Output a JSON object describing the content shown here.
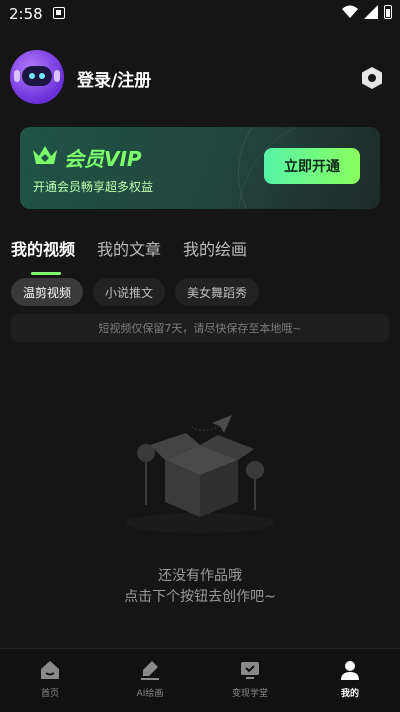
{
  "status": {
    "time": "2:58"
  },
  "profile": {
    "login_label": "登录/注册"
  },
  "vip": {
    "title": "会员VIP",
    "subtitle": "开通会员畅享超多权益",
    "button": "立即开通",
    "accent": "#7dff6b"
  },
  "tabs": [
    {
      "label": "我的视频",
      "active": true
    },
    {
      "label": "我的文章",
      "active": false
    },
    {
      "label": "我的绘画",
      "active": false
    }
  ],
  "chips": [
    {
      "label": "温剪视频",
      "active": true
    },
    {
      "label": "小说推文",
      "active": false
    },
    {
      "label": "美女舞蹈秀",
      "active": false
    }
  ],
  "notice": "短视频仅保留7天，请尽快保存至本地哦~",
  "empty": {
    "line1": "还没有作品哦",
    "line2": "点击下个按钮去创作吧~"
  },
  "nav": [
    {
      "label": "首页",
      "icon": "home-icon",
      "active": false
    },
    {
      "label": "AI绘画",
      "icon": "brush-icon",
      "active": false
    },
    {
      "label": "变现学堂",
      "icon": "classroom-icon",
      "active": false
    },
    {
      "label": "我的",
      "icon": "user-icon",
      "active": true
    }
  ]
}
